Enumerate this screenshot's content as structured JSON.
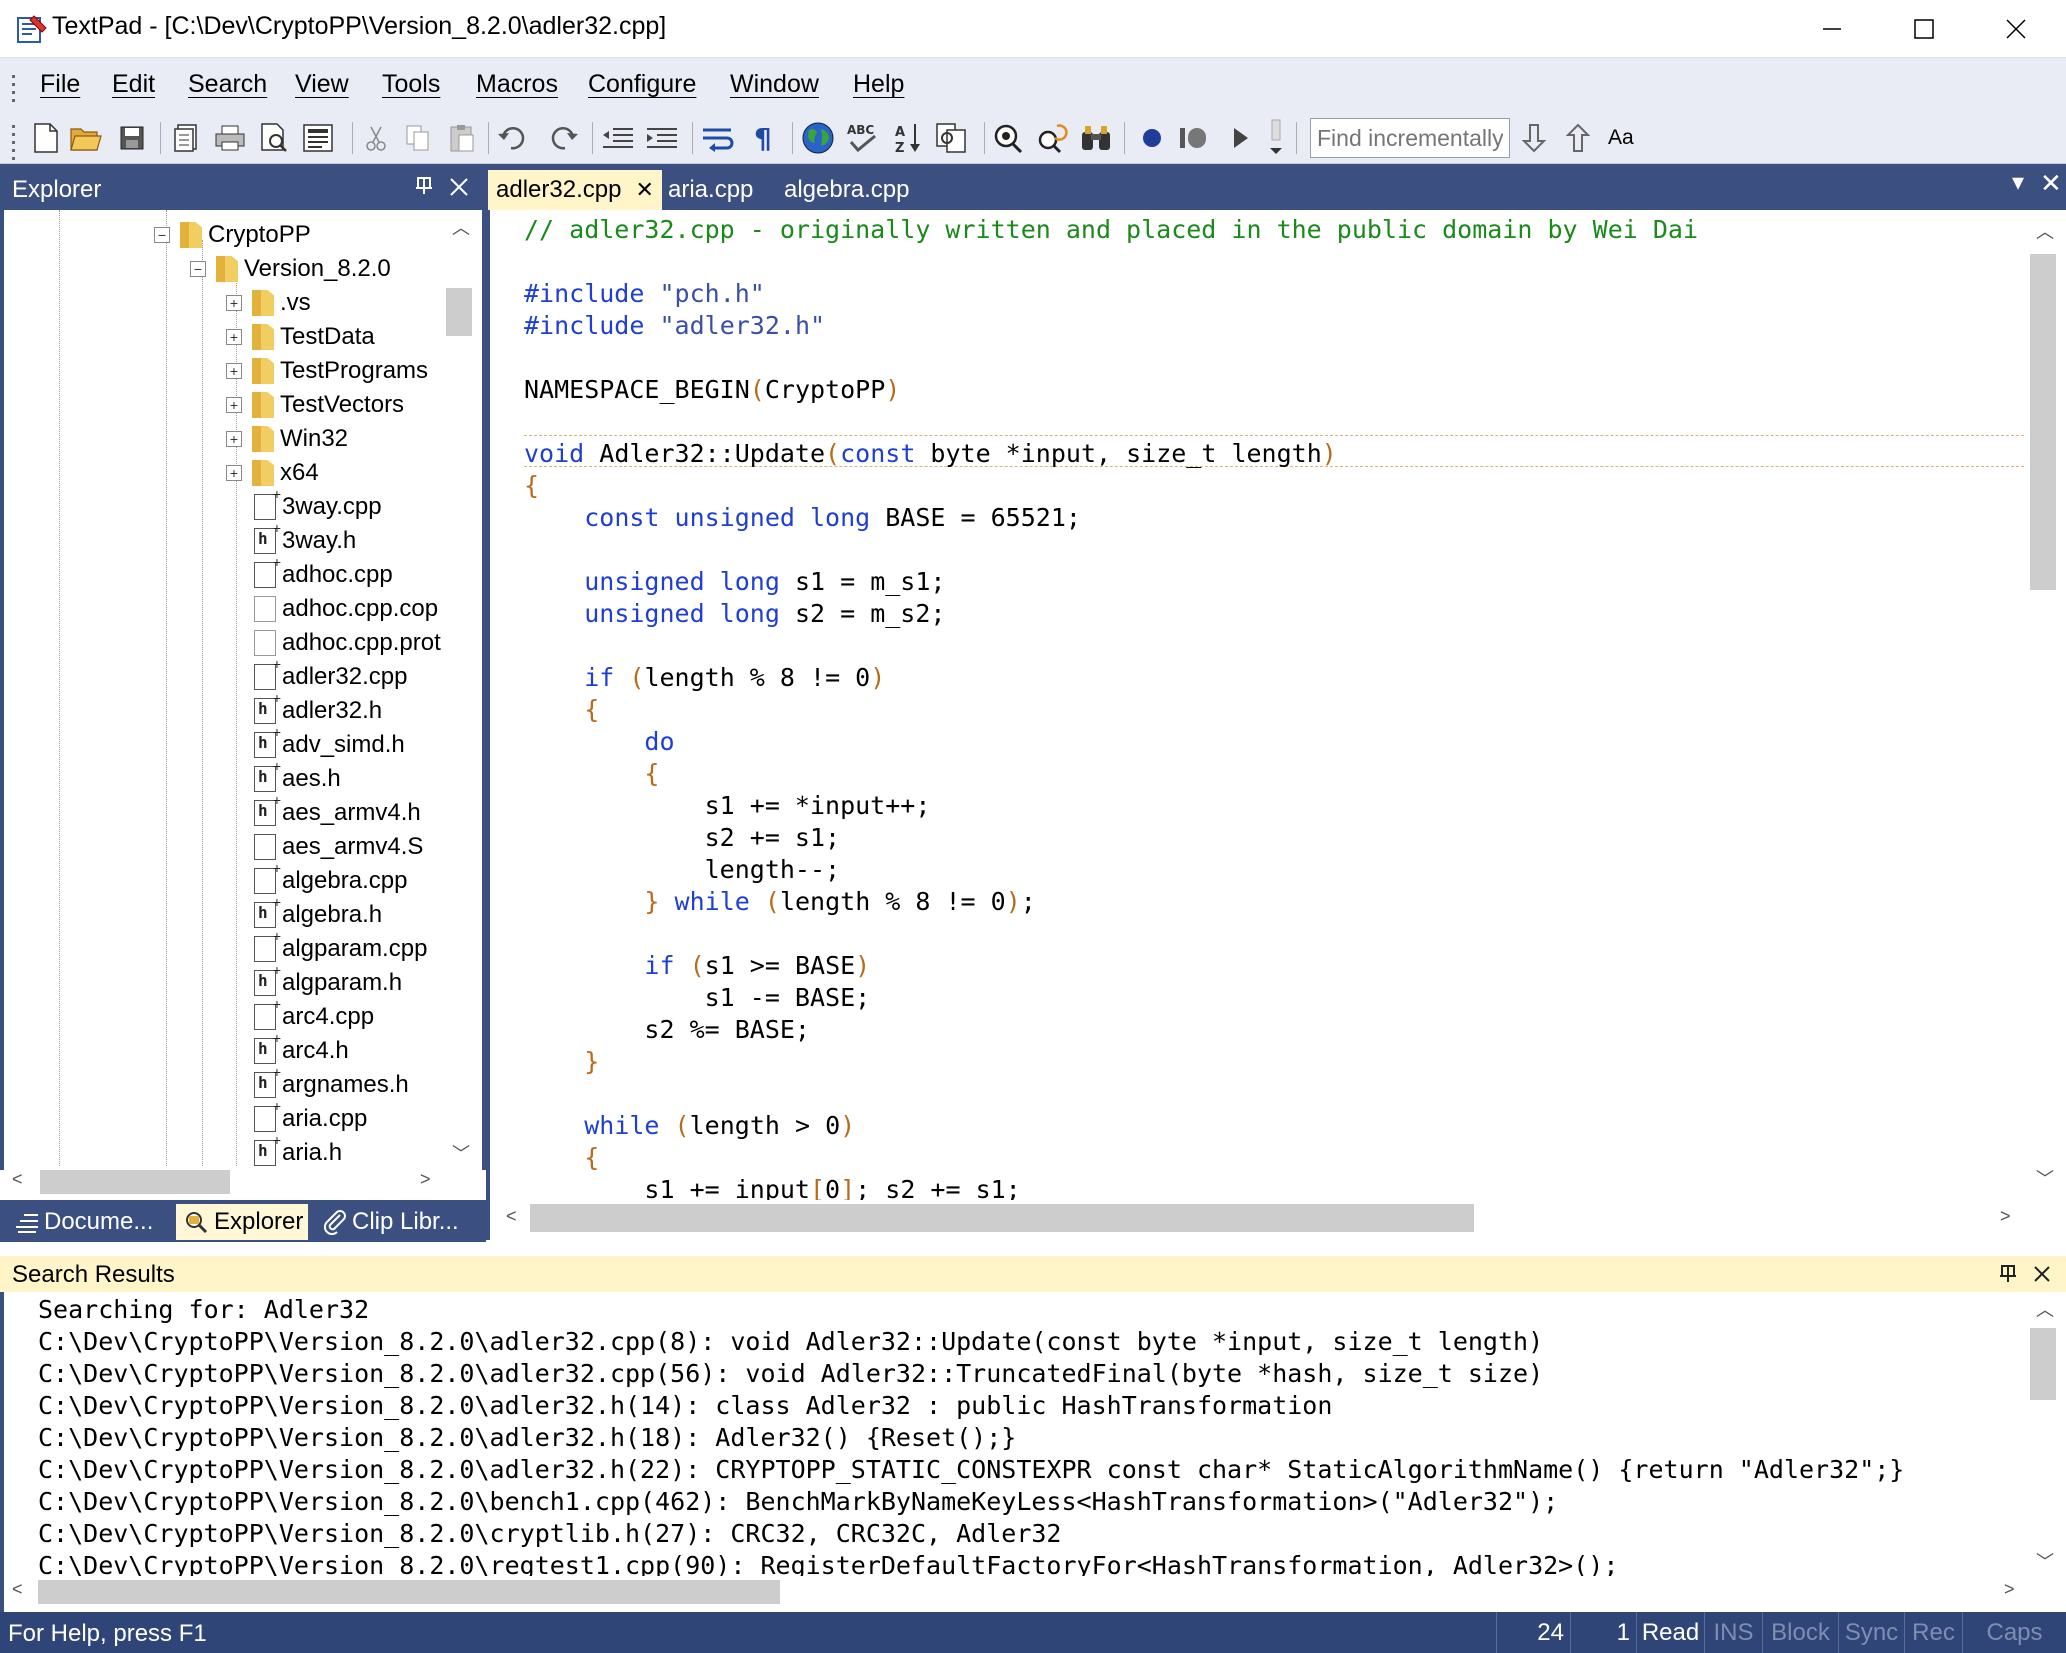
{
  "window": {
    "title": "TextPad - [C:\\Dev\\CryptoPP\\Version_8.2.0\\adler32.cpp]",
    "minimize": "—",
    "maximize": "☐",
    "close": "✕"
  },
  "menu": [
    "File",
    "Edit",
    "Search",
    "View",
    "Tools",
    "Macros",
    "Configure",
    "Window",
    "Help"
  ],
  "toolbar": {
    "find_placeholder": "Find incrementally",
    "match_case_label": "Aa",
    "icons": [
      "new-file-icon",
      "open-folder-icon",
      "save-icon",
      "save-all-icon",
      "print-icon",
      "print-preview-icon",
      "document-properties-icon",
      "cut-icon",
      "copy-icon",
      "paste-icon",
      "undo-icon",
      "redo-icon",
      "outdent-icon",
      "indent-icon",
      "word-wrap-icon",
      "pilcrow-icon",
      "globe-icon",
      "spell-check-icon",
      "sort-icon",
      "compare-icon",
      "find-icon",
      "find-in-files-icon",
      "binoculars-icon",
      "record-macro-icon",
      "pause-macro-icon",
      "play-macro-icon",
      "find-next-icon",
      "find-previous-icon"
    ]
  },
  "explorer": {
    "title": "Explorer",
    "pin": "⊥",
    "close": "✕",
    "tree": [
      {
        "label": "CryptoPP",
        "type": "folder",
        "level": 0,
        "expander": "−"
      },
      {
        "label": "Version_8.2.0",
        "type": "folder",
        "level": 1,
        "expander": "−"
      },
      {
        "label": ".vs",
        "type": "folder",
        "level": 2,
        "expander": "+"
      },
      {
        "label": "TestData",
        "type": "folder",
        "level": 2,
        "expander": "+"
      },
      {
        "label": "TestPrograms",
        "type": "folder",
        "level": 2,
        "expander": "+"
      },
      {
        "label": "TestVectors",
        "type": "folder",
        "level": 2,
        "expander": "+"
      },
      {
        "label": "Win32",
        "type": "folder",
        "level": 2,
        "expander": "+"
      },
      {
        "label": "x64",
        "type": "folder",
        "level": 2,
        "expander": "+"
      },
      {
        "label": "3way.cpp",
        "type": "cpp",
        "level": 2
      },
      {
        "label": "3way.h",
        "type": "h",
        "level": 2
      },
      {
        "label": "adhoc.cpp",
        "type": "cpp",
        "level": 2
      },
      {
        "label": "adhoc.cpp.cop",
        "type": "plain",
        "level": 2
      },
      {
        "label": "adhoc.cpp.prot",
        "type": "plain",
        "level": 2
      },
      {
        "label": "adler32.cpp",
        "type": "cpp",
        "level": 2
      },
      {
        "label": "adler32.h",
        "type": "h",
        "level": 2
      },
      {
        "label": "adv_simd.h",
        "type": "h",
        "level": 2
      },
      {
        "label": "aes.h",
        "type": "h",
        "level": 2
      },
      {
        "label": "aes_armv4.h",
        "type": "h",
        "level": 2
      },
      {
        "label": "aes_armv4.S",
        "type": "asm",
        "level": 2
      },
      {
        "label": "algebra.cpp",
        "type": "cpp",
        "level": 2
      },
      {
        "label": "algebra.h",
        "type": "h",
        "level": 2
      },
      {
        "label": "algparam.cpp",
        "type": "cpp",
        "level": 2
      },
      {
        "label": "algparam.h",
        "type": "h",
        "level": 2
      },
      {
        "label": "arc4.cpp",
        "type": "cpp",
        "level": 2
      },
      {
        "label": "arc4.h",
        "type": "h",
        "level": 2
      },
      {
        "label": "argnames.h",
        "type": "h",
        "level": 2
      },
      {
        "label": "aria.cpp",
        "type": "cpp",
        "level": 2
      },
      {
        "label": "aria.h",
        "type": "h",
        "level": 2
      }
    ]
  },
  "panel_tabs": [
    "Docume...",
    "Explorer",
    "Clip Libr..."
  ],
  "doc_tabs": [
    {
      "label": "adler32.cpp",
      "active": true,
      "close": "✕"
    },
    {
      "label": "aria.cpp",
      "active": false
    },
    {
      "label": "algebra.cpp",
      "active": false
    }
  ],
  "doc_tabs_controls": {
    "menu": "▾",
    "close": "✕"
  },
  "code_lines": [
    [
      [
        "// adler32.cpp - originally written and placed in the public domain by Wei Dai",
        "com"
      ]
    ],
    [],
    [
      [
        "#include",
        "kw"
      ],
      [
        " ",
        ""
      ],
      [
        "\"pch.h\"",
        "str"
      ]
    ],
    [
      [
        "#include",
        "kw"
      ],
      [
        " ",
        ""
      ],
      [
        "\"adler32.h\"",
        "str"
      ]
    ],
    [],
    [
      [
        "NAMESPACE_BEGIN",
        ""
      ],
      [
        "(",
        "par"
      ],
      [
        "CryptoPP",
        ""
      ],
      [
        ")",
        "par"
      ]
    ],
    [],
    [
      [
        "void",
        "kw"
      ],
      [
        " Adler32::Update",
        ""
      ],
      [
        "(",
        "par"
      ],
      [
        "const",
        "kw"
      ],
      [
        " byte *input, size_t length",
        ""
      ],
      [
        ")",
        "par"
      ]
    ],
    [
      [
        "{",
        "par"
      ]
    ],
    [
      [
        "    ",
        ""
      ],
      [
        "const unsigned long",
        "kw"
      ],
      [
        " BASE = 65521;",
        ""
      ]
    ],
    [],
    [
      [
        "    ",
        ""
      ],
      [
        "unsigned long",
        "kw"
      ],
      [
        " s1 = m_s1;",
        ""
      ]
    ],
    [
      [
        "    ",
        ""
      ],
      [
        "unsigned long",
        "kw"
      ],
      [
        " s2 = m_s2;",
        ""
      ]
    ],
    [],
    [
      [
        "    ",
        ""
      ],
      [
        "if",
        "kw"
      ],
      [
        " ",
        ""
      ],
      [
        "(",
        "par"
      ],
      [
        "length % 8 != 0",
        ""
      ],
      [
        ")",
        "par"
      ]
    ],
    [
      [
        "    ",
        ""
      ],
      [
        "{",
        "par"
      ]
    ],
    [
      [
        "        ",
        ""
      ],
      [
        "do",
        "kw"
      ]
    ],
    [
      [
        "        ",
        ""
      ],
      [
        "{",
        "par"
      ]
    ],
    [
      [
        "            s1 += *input++;",
        ""
      ]
    ],
    [
      [
        "            s2 += s1;",
        ""
      ]
    ],
    [
      [
        "            length--;",
        ""
      ]
    ],
    [
      [
        "        ",
        ""
      ],
      [
        "}",
        "par"
      ],
      [
        " ",
        ""
      ],
      [
        "while",
        "kw"
      ],
      [
        " ",
        ""
      ],
      [
        "(",
        "par"
      ],
      [
        "length % 8 != 0",
        ""
      ],
      [
        ")",
        "par"
      ],
      [
        ";",
        ""
      ]
    ],
    [],
    [
      [
        "        ",
        ""
      ],
      [
        "if",
        "kw"
      ],
      [
        " ",
        ""
      ],
      [
        "(",
        "par"
      ],
      [
        "s1 >= BASE",
        ""
      ],
      [
        ")",
        "par"
      ]
    ],
    [
      [
        "            s1 -= BASE;",
        ""
      ]
    ],
    [
      [
        "        s2 %= BASE;",
        ""
      ]
    ],
    [
      [
        "    ",
        ""
      ],
      [
        "}",
        "par"
      ]
    ],
    [],
    [
      [
        "    ",
        ""
      ],
      [
        "while",
        "kw"
      ],
      [
        " ",
        ""
      ],
      [
        "(",
        "par"
      ],
      [
        "length > 0",
        ""
      ],
      [
        ")",
        "par"
      ]
    ],
    [
      [
        "    ",
        ""
      ],
      [
        "{",
        "par"
      ]
    ],
    [
      [
        "        s1 += input",
        ""
      ],
      [
        "[",
        "par"
      ],
      [
        "0",
        ""
      ],
      [
        "]",
        "par"
      ],
      [
        "; s2 += s1;",
        ""
      ]
    ]
  ],
  "search_results": {
    "title": "Search Results",
    "pin": "⊥",
    "close": "✕",
    "lines": [
      "Searching for: Adler32",
      "C:\\Dev\\CryptoPP\\Version_8.2.0\\adler32.cpp(8): void Adler32::Update(const byte *input, size_t length)",
      "C:\\Dev\\CryptoPP\\Version_8.2.0\\adler32.cpp(56): void Adler32::TruncatedFinal(byte *hash, size_t size)",
      "C:\\Dev\\CryptoPP\\Version_8.2.0\\adler32.h(14): class Adler32 : public HashTransformation",
      "C:\\Dev\\CryptoPP\\Version_8.2.0\\adler32.h(18): Adler32() {Reset();}",
      "C:\\Dev\\CryptoPP\\Version_8.2.0\\adler32.h(22): CRYPTOPP_STATIC_CONSTEXPR const char* StaticAlgorithmName() {return \"Adler32\";}",
      "C:\\Dev\\CryptoPP\\Version_8.2.0\\bench1.cpp(462): BenchMarkByNameKeyLess<HashTransformation>(\"Adler32\");",
      "C:\\Dev\\CryptoPP\\Version_8.2.0\\cryptlib.h(27): CRC32, CRC32C, Adler32",
      "C:\\Dev\\CryptoPP\\Version_8.2.0\\regtest1.cpp(90): RegisterDefaultFactoryFor<HashTransformation, Adler32>();"
    ]
  },
  "status": {
    "help": "For Help, press F1",
    "line": "24",
    "column": "1",
    "read": "Read",
    "ins": "INS",
    "block": "Block",
    "sync": "Sync",
    "rec": "Rec",
    "caps": "Caps"
  },
  "colors": {
    "panel_header": "#3b4f81",
    "active_tab": "#fff5c8",
    "comment": "#1a8a1a",
    "keyword": "#1f3fd0",
    "string": "#3a50a6",
    "paren": "#b86b1a",
    "status_bar": "#2f4577"
  }
}
